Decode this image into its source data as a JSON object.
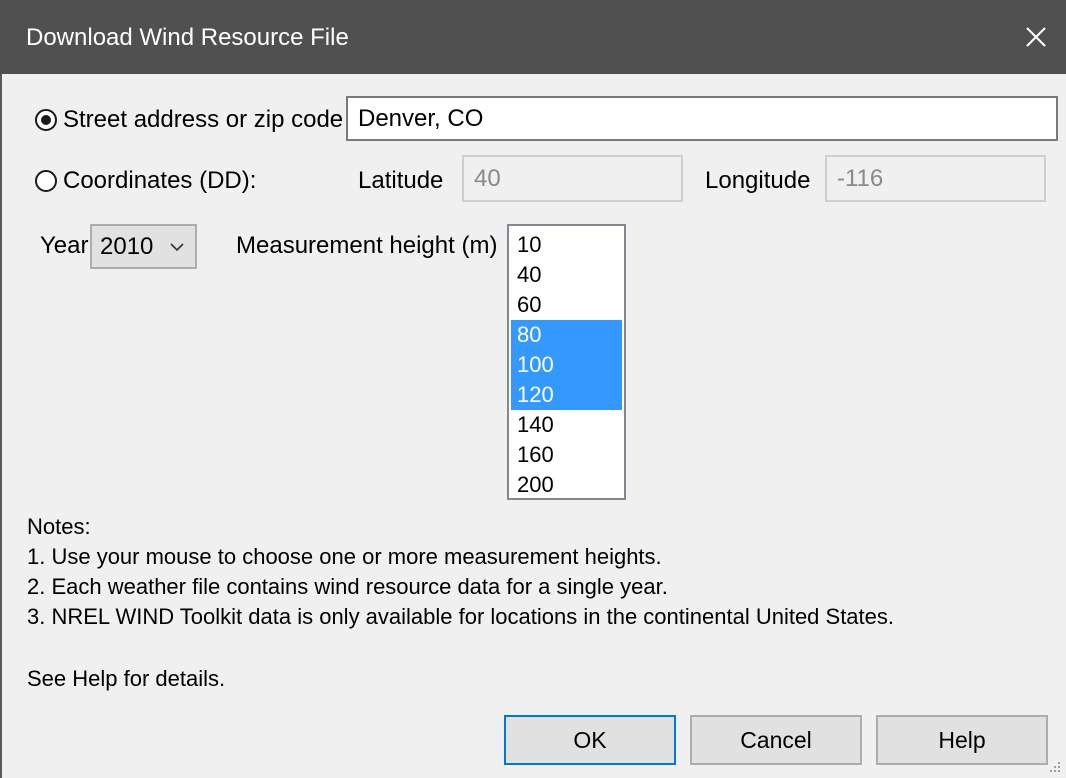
{
  "window": {
    "title": "Download Wind Resource File",
    "close_icon": "close-icon"
  },
  "location": {
    "address_option_label": "Street address or zip code",
    "address_selected": true,
    "address_value": "Denver, CO",
    "coordinates_option_label": "Coordinates (DD):",
    "latitude_label": "Latitude",
    "latitude_value": "40",
    "longitude_label": "Longitude",
    "longitude_value": "-116"
  },
  "year": {
    "label": "Year",
    "selected": "2010"
  },
  "heights": {
    "label": "Measurement height (m)",
    "items": [
      {
        "value": "10",
        "selected": false
      },
      {
        "value": "40",
        "selected": false
      },
      {
        "value": "60",
        "selected": false
      },
      {
        "value": "80",
        "selected": true
      },
      {
        "value": "100",
        "selected": true
      },
      {
        "value": "120",
        "selected": true
      },
      {
        "value": "140",
        "selected": false
      },
      {
        "value": "160",
        "selected": false
      },
      {
        "value": "200",
        "selected": false
      }
    ]
  },
  "notes": {
    "heading": "Notes:",
    "lines": [
      "1. Use your mouse to choose one or more measurement heights.",
      "2. Each weather file contains wind resource data for a single year.",
      "3. NREL WIND Toolkit data is only available for locations in the continental United States."
    ],
    "see_help": "See Help for details."
  },
  "buttons": {
    "ok": "OK",
    "cancel": "Cancel",
    "help": "Help"
  },
  "colors": {
    "titlebar": "#505050",
    "selection": "#3399ff",
    "default_button_border": "#0078d7"
  }
}
